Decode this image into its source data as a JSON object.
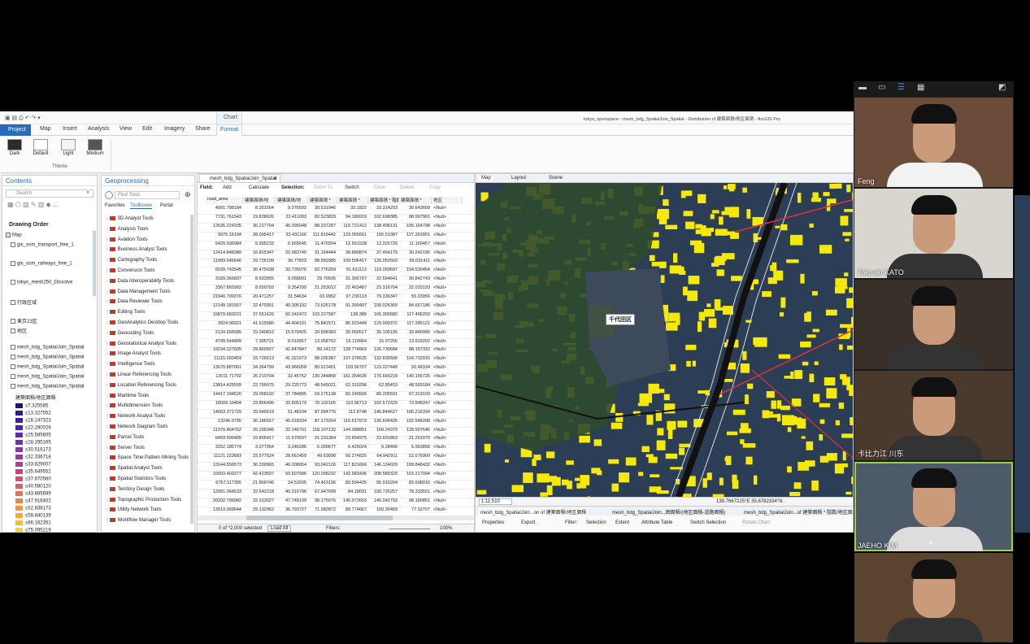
{
  "window_title": "tokyo_openspace - mesh_bdg_SpatialJoin_Spatial - Distribution of 建築面積/地区面積 - ArcGIS Pro",
  "ribbon": {
    "context": "Chart",
    "tabs": [
      "Project",
      "Map",
      "Insert",
      "Analysis",
      "View",
      "Edit",
      "Imagery",
      "Share",
      "Format"
    ],
    "theme_tiles": [
      "Dark",
      "Default",
      "Light",
      "Medium"
    ],
    "group_label": "Theme"
  },
  "contents": {
    "title": "Contents",
    "search_placeholder": "Search",
    "drawing_order": "Drawing Order",
    "layers": [
      "Map",
      "gis_osm_transport_free_1",
      "gis_osm_railways_free_1",
      "tokyo_mesh250_Dissolve",
      "行政区域",
      "東京23区",
      "地区",
      "mesh_bdg_SpatialJoin_Spatial",
      "mesh_bdg_SpatialJoin_Spatial",
      "mesh_bdg_SpatialJoin_Spatial",
      "mesh_bdg_SpatialJoin_Spatial",
      "mesh_bdg_SpatialJoin_Spatial"
    ],
    "legend_title": "建築面積/地区面積",
    "legend": [
      {
        "label": "≤7.325585",
        "color": "#1a1470"
      },
      {
        "label": "≤13.327552",
        "color": "#2a1a8c"
      },
      {
        "label": "≤18.247323",
        "color": "#3a1fa3"
      },
      {
        "label": "≤22.280026",
        "color": "#4b22b0"
      },
      {
        "label": "≤25.585605",
        "color": "#6126b7"
      },
      {
        "label": "≤28.295165",
        "color": "#782bb6"
      },
      {
        "label": "≤30.516173",
        "color": "#8d30ad"
      },
      {
        "label": "≤32.336718",
        "color": "#a0369e"
      },
      {
        "label": "≤33.829007",
        "color": "#b13d8f"
      },
      {
        "label": "≤35.649552",
        "color": "#c04681"
      },
      {
        "label": "≤37.870560",
        "color": "#cf5272"
      },
      {
        "label": "≤40.580120",
        "color": "#dc6163"
      },
      {
        "label": "≤43.885699",
        "color": "#e77152"
      },
      {
        "label": "≤47.916402",
        "color": "#ef8343"
      },
      {
        "label": "≤52.838173",
        "color": "#f59635"
      },
      {
        "label": "≤58.840139",
        "color": "#f8a92a"
      },
      {
        "label": "≤66.162351",
        "color": "#f9bd24"
      },
      {
        "label": "≤75.095219",
        "color": "#f7d426"
      }
    ]
  },
  "geoprocessing": {
    "title": "Geoprocessing",
    "search_placeholder": "Find Tools",
    "tabs": [
      "Favorites",
      "Toolboxes",
      "Portal"
    ],
    "toolboxes": [
      "3D Analyst Tools",
      "Analysis Tools",
      "Aviation Tools",
      "Business Analyst Tools",
      "Cartography Tools",
      "Conversion Tools",
      "Data Interoperability Tools",
      "Data Management Tools",
      "Data Reviewer Tools",
      "Editing Tools",
      "GeoAnalytics Desktop Tools",
      "Geocoding Tools",
      "Geostatistical Analyst Tools",
      "Image Analyst Tools",
      "Intelligence Tools",
      "Linear Referencing Tools",
      "Location Referencing Tools",
      "Maritime Tools",
      "Multidimension Tools",
      "Network Analyst Tools",
      "Network Diagram Tools",
      "Parcel Tools",
      "Server Tools",
      "Space Time Pattern Mining Tools",
      "Spatial Analyst Tools",
      "Spatial Statistics Tools",
      "Territory Design Tools",
      "Topographic Production Tools",
      "Utility Network Tools",
      "Workflow Manager Tools"
    ]
  },
  "table": {
    "tab": "mesh_bdg_SpatialJoin_Spatial",
    "toolbar": [
      "Field:",
      "Add",
      "Calculate",
      "Selection:",
      "Zoom To",
      "Switch",
      "Clear",
      "Delete",
      "Copy"
    ],
    "columns": [
      "road_area",
      "建築面積/地",
      "建築面積/地",
      "建築面積 *",
      "建築面積 *",
      "建築面積 * 階数",
      "建築面積 * ",
      "地区"
    ],
    "rows": [
      [
        "4991.788184",
        "8.351564",
        "9.076503",
        "30.531946",
        "33.1822",
        "33.314203",
        "30.643668",
        "<Null>"
      ],
      [
        "7731.761543",
        "19.838626",
        "22.411093",
        "82.523833",
        "94.180919",
        "102.698385",
        "88.997901",
        "<Null>"
      ],
      [
        "12635.224335",
        "36.217704",
        "45.395048",
        "88.337287",
        "110.721412",
        "138.498131",
        "105.164798",
        "<Null>"
      ],
      [
        "9975.16194",
        "28.095417",
        "33.431166",
        "111.819442",
        "133.055661",
        "155.51087",
        "127.262801",
        "<Null>"
      ],
      [
        "5429.936984",
        "5.995233",
        "6.565645",
        "11.470204",
        "12.561528",
        "12.201726",
        "11.169457",
        "<Null>"
      ],
      [
        "12414.848389",
        "16.815347",
        "20.983745",
        "31.164444",
        "38.889874",
        "37.464175",
        "30.242195",
        "<Null>"
      ],
      [
        "11983.945646",
        "29.726199",
        "36.77823",
        "88.581885",
        "109.596417",
        "126.052503",
        "99.031411",
        "<Null>"
      ],
      [
        "6039.743545",
        "30.475038",
        "33.735076",
        "82.776209",
        "91.631113",
        "119.059697",
        "104.530454",
        "<Null>"
      ],
      [
        "3189.366837",
        "8.593955",
        "9.058091",
        "29.76605",
        "31.366707",
        "32.564641",
        "30.842743",
        "<Null>"
      ],
      [
        "3367.865992",
        "8.650703",
        "9.354799",
        "21.253012",
        "22.463487",
        "23.316704",
        "22.015193",
        "<Null>"
      ],
      [
        "21940.709376",
        "20.471257",
        "31.54634",
        "63.0952",
        "97.230113",
        "79.336347",
        "55.03956",
        "<Null>"
      ],
      [
        "12149.181507",
        "32.470301",
        "40.305192",
        "73.625178",
        "91.390497",
        "109.026369",
        "84.657186",
        "<Null>"
      ],
      [
        "15879.683221",
        "37.551626",
        "50.342473",
        "103.227587",
        "138.389",
        "165.300682",
        "117.496293",
        "<Null>"
      ],
      [
        "3924.96921",
        "41.615586",
        "44.404101",
        "75.841571",
        "80.923449",
        "129.900372",
        "117.285121",
        "<Null>"
      ],
      [
        "2124.656585",
        "15.049816",
        "15.579425",
        "29.898383",
        "30.950517",
        "35.195195",
        "33.840996",
        "<Null>"
      ],
      [
        "4799.544899",
        "7.395721",
        "8.019957",
        "13.958762",
        "15.119964",
        "15.07256",
        "13.919202",
        "<Null>"
      ],
      [
        "19234.227605",
        "29.860507",
        "42.847847",
        "89.14172",
        "128.774963",
        "126.730684",
        "88.157332",
        "<Null>"
      ],
      [
        "11115.093459",
        "33.726513",
        "41.021973",
        "88.035387",
        "107.078525",
        "132.836509",
        "104.732015",
        "<Null>"
      ],
      [
        "13670.887061",
        "34.364799",
        "43.966058",
        "80.913401",
        "103.56707",
        "123.227449",
        "92.46334",
        "<Null>"
      ],
      [
        "12011.71792",
        "26.219704",
        "32.45752",
        "130.344858",
        "161.354635",
        "176.666218",
        "140.155726",
        "<Null>"
      ],
      [
        "13814.425599",
        "22.766075",
        "29.225773",
        "48.545021",
        "62.319296",
        "62.85453",
        "48.569184",
        "<Null>"
      ],
      [
        "14417.194526",
        "29.068192",
        "37.784895",
        "63.275138",
        "82.249506",
        "89.205591",
        "67.313199",
        "<Null>"
      ],
      [
        "18509.10404",
        "23.856496",
        "33.895179",
        "78.102165",
        "110.96713",
        "102.572329",
        "73.848247",
        "<Null>"
      ],
      [
        "14003.371729",
        "39.946519",
        "51.48104",
        "87.584776",
        "112.8748",
        "145.844627",
        "106.216334",
        "<Null>"
      ],
      [
        "13246.0735",
        "36.186557",
        "45.918334",
        "87.173264",
        "110.617073",
        "136.606426",
        "102.548208",
        "<Null>"
      ],
      [
        "11376.464762",
        "26.295345",
        "32.146701",
        "118.107132",
        "144.388851",
        "160.24379",
        "128.507646",
        "<Null>"
      ],
      [
        "6403.690405",
        "10.805417",
        "11.570937",
        "21.231364",
        "23.654975",
        "23.691863",
        "21.261075",
        "<Null>"
      ],
      [
        "3252.185774",
        "3.077354",
        "3.246285",
        "6.090677",
        "6.425024",
        "6.28406",
        "5.963858",
        "<Null>"
      ],
      [
        "11121.323683",
        "23.577524",
        "28.661459",
        "49.63098",
        "60.374825",
        "64.942911",
        "52.676909",
        "<Null>"
      ],
      [
        "13144.556573",
        "36.330965",
        "46.008654",
        "93.042126",
        "117.821666",
        "146.134029",
        "109.848432",
        "<Null>"
      ],
      [
        "10003.403277",
        "42.423597",
        "50.507586",
        "120.098232",
        "142.983436",
        "208.589329",
        "163.217094",
        "<Null>"
      ],
      [
        "6767.117355",
        "21.860746",
        "24.51505",
        "74.463196",
        "83.504425",
        "95.916204",
        "83.698016",
        "<Null>"
      ],
      [
        "12051.064533",
        "32.542218",
        "40.316796",
        "67.947699",
        "84.18091",
        "100.726257",
        "78.333551",
        "<Null>"
      ],
      [
        "20202.706982",
        "32.313027",
        "47.749139",
        "98.175076",
        "145.073653",
        "145.042793",
        "98.180851",
        "<Null>"
      ],
      [
        "13013.069644",
        "29.132962",
        "36.793727",
        "71.082872",
        "89.774667",
        "100.30459",
        "77.52707",
        "<Null>"
      ]
    ],
    "footer_selected": "0 of *2,000 selected",
    "footer_load": "Load All",
    "footer_filters": "Filters:",
    "footer_zoom": "100%"
  },
  "map": {
    "tabs": [
      "Map",
      "Layout",
      "Scene"
    ],
    "label": "千代田区",
    "scale": "1:11,510",
    "coords": "139.7667225°E 35.6782334°N",
    "bottom_tabs": [
      "mesh_bdg_SpatialJoin...on of 建築面積/地区面積",
      "mesh_bdg_SpatialJoin...囲面積/(地区面積-道路面積)",
      "mesh_bdg_SpatialJoin...of 建築面積 * 階数/地区面"
    ],
    "bottom_tools": [
      "Properties",
      "Export",
      "Filter:",
      "Selection",
      "Extent",
      "Attribute Table",
      "Switch Selection",
      "Rotate Chart"
    ]
  },
  "participants": [
    {
      "name": "Feng",
      "color": "#6b4c3a"
    },
    {
      "name": "Takaaki KATO",
      "color": "#d9d6d0"
    },
    {
      "name": "",
      "color": "#3a302a"
    },
    {
      "name": "卡比力江 川东",
      "color": "#4a3a2e"
    },
    {
      "name": "JAEHO KIM",
      "color": "#4d5a6a"
    },
    {
      "name": "",
      "color": "#5a4430"
    }
  ]
}
